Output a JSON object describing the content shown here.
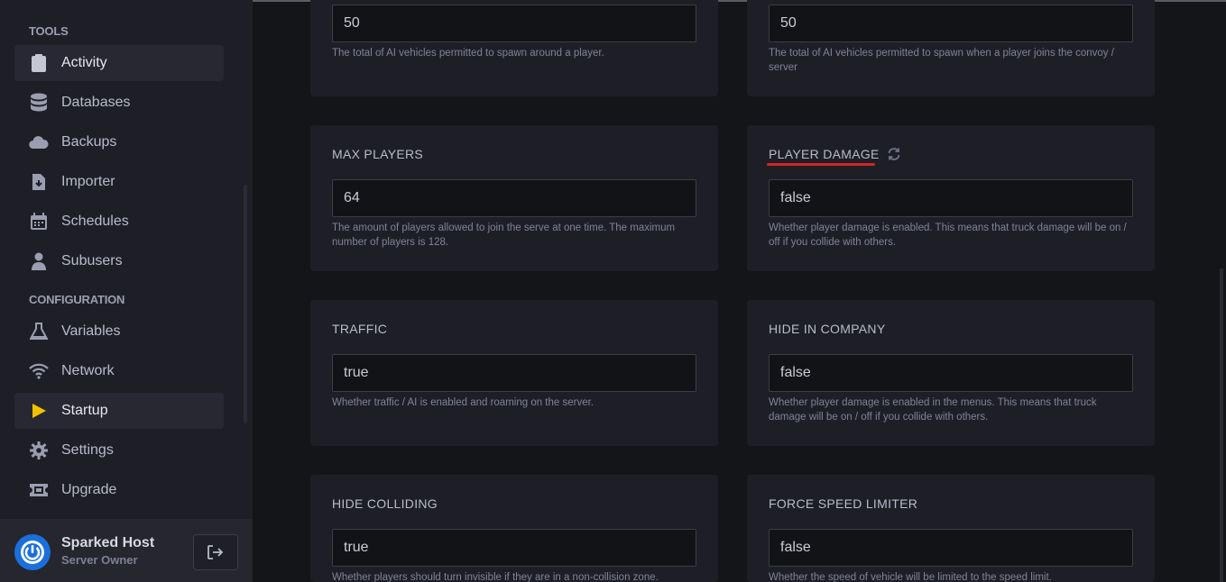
{
  "sidebar": {
    "tools_label": "TOOLS",
    "config_label": "CONFIGURATION",
    "items": [
      {
        "label": "Activity",
        "icon": "clipboard-icon"
      },
      {
        "label": "Databases",
        "icon": "database-icon"
      },
      {
        "label": "Backups",
        "icon": "cloud-icon"
      },
      {
        "label": "Importer",
        "icon": "file-import-icon"
      },
      {
        "label": "Schedules",
        "icon": "calendar-icon"
      },
      {
        "label": "Subusers",
        "icon": "user-icon"
      },
      {
        "label": "Variables",
        "icon": "flask-icon"
      },
      {
        "label": "Network",
        "icon": "wifi-icon"
      },
      {
        "label": "Startup",
        "icon": "play-icon"
      },
      {
        "label": "Settings",
        "icon": "gear-icon"
      },
      {
        "label": "Upgrade",
        "icon": "ticket-icon"
      }
    ],
    "active_item": "Startup"
  },
  "user": {
    "name": "Sparked Host",
    "role": "Server Owner"
  },
  "cards": [
    {
      "title": "",
      "value": "50",
      "desc": "The total of AI vehicles permitted to spawn around a player."
    },
    {
      "title": "",
      "value": "50",
      "desc": "The total of AI vehicles permitted to spawn when a player joins the convoy / server"
    },
    {
      "title": "MAX PLAYERS",
      "value": "64",
      "desc": "The amount of players allowed to join the serve at one time. The maximum number of players is 128."
    },
    {
      "title": "PLAYER DAMAGE",
      "value": "false",
      "desc": "Whether player damage is enabled. This means that truck damage will be on / off if you collide with others."
    },
    {
      "title": "TRAFFIC",
      "value": "true",
      "desc": "Whether traffic / AI is enabled and roaming on the server."
    },
    {
      "title": "HIDE IN COMPANY",
      "value": "false",
      "desc": "Whether player damage is enabled in the menus. This means that truck damage will be on / off if you collide with others."
    },
    {
      "title": "HIDE COLLIDING",
      "value": "true",
      "desc": "Whether players should turn invisible if they are in a non-collision zone."
    },
    {
      "title": "FORCE SPEED LIMITER",
      "value": "false",
      "desc": "Whether the speed of vehicle will be limited to the speed limit."
    }
  ],
  "colors": {
    "accent_active": "#f2c200",
    "avatar_blue": "#1a6fdb",
    "annotation_red": "#d12424"
  }
}
